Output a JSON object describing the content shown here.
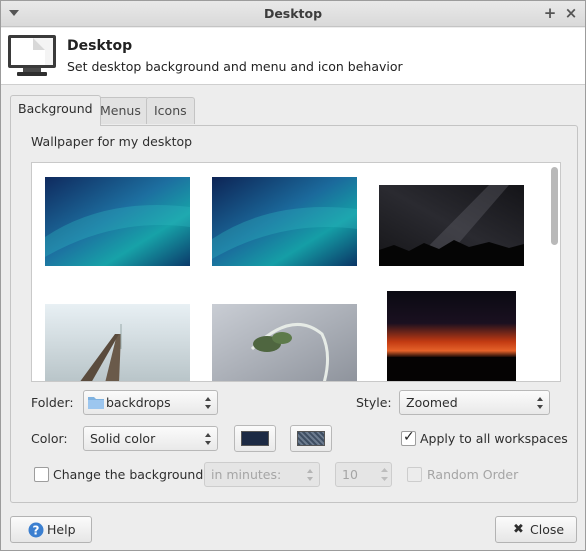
{
  "window": {
    "title": "Desktop"
  },
  "header": {
    "title": "Desktop",
    "subtitle": "Set desktop background and menu and icon behavior"
  },
  "tabs": [
    {
      "label": "Background",
      "active": true
    },
    {
      "label": "Menus",
      "active": false
    },
    {
      "label": "Icons",
      "active": false
    }
  ],
  "background": {
    "section_label": "Wallpaper for my desktop",
    "wallpapers": [
      {
        "name": "aurora-blue-1"
      },
      {
        "name": "aurora-blue-2"
      },
      {
        "name": "milky-way"
      },
      {
        "name": "foggy-rails"
      },
      {
        "name": "frosted-plant"
      },
      {
        "name": "red-sunset"
      }
    ],
    "folder_label": "Folder:",
    "folder_value": "backdrops",
    "style_label": "Style:",
    "style_value": "Zoomed",
    "color_label": "Color:",
    "color_value": "Solid color",
    "primary_color": "#1c2a44",
    "apply_all_label": "Apply to all workspaces",
    "apply_all_checked": true,
    "change_bg_label": "Change the background",
    "change_bg_checked": false,
    "interval_unit": "in minutes:",
    "interval_value": "10",
    "random_order_label": "Random Order"
  },
  "footer": {
    "help_label": "Help",
    "close_label": "Close"
  }
}
